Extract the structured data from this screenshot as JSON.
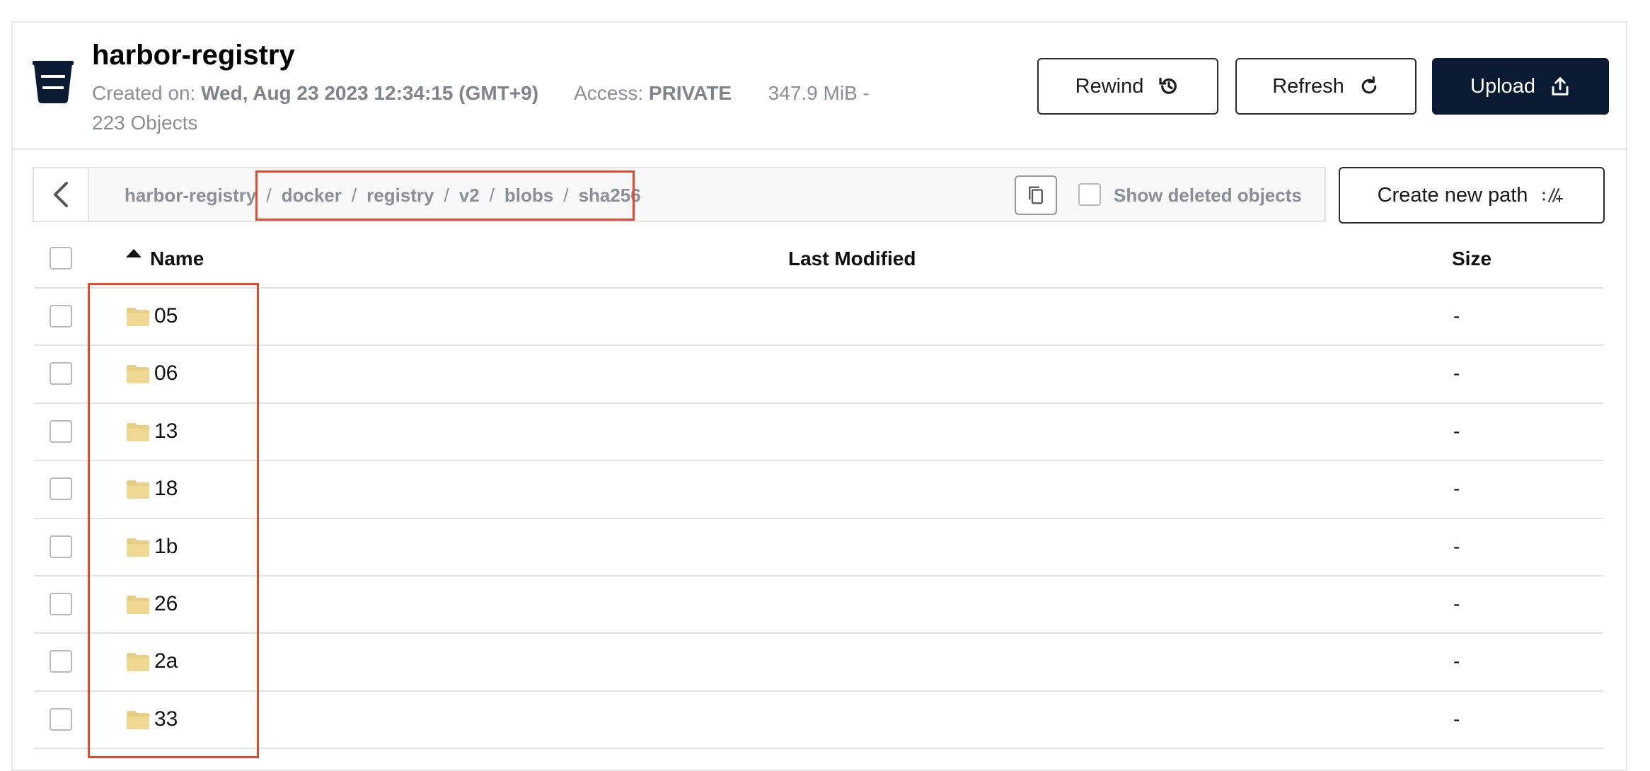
{
  "bucket": {
    "name": "harbor-registry",
    "created_label": "Created on:",
    "created_value": "Wed, Aug 23 2023 12:34:15 (GMT+9)",
    "access_label": "Access:",
    "access_value": "PRIVATE",
    "size_text": "347.9 MiB -",
    "objects_text": "223 Objects"
  },
  "toolbar": {
    "rewind_label": "Rewind",
    "refresh_label": "Refresh",
    "upload_label": "Upload",
    "create_path_label": "Create new path"
  },
  "breadcrumb": {
    "items": [
      "harbor-registry",
      "docker",
      "registry",
      "v2",
      "blobs",
      "sha256"
    ],
    "separator": "/"
  },
  "options": {
    "show_deleted_label": "Show deleted objects",
    "show_deleted_checked": false
  },
  "table": {
    "columns": {
      "name": "Name",
      "last_modified": "Last Modified",
      "size": "Size"
    },
    "rows": [
      {
        "name": "05",
        "last_modified": "",
        "size": "-"
      },
      {
        "name": "06",
        "last_modified": "",
        "size": "-"
      },
      {
        "name": "13",
        "last_modified": "",
        "size": "-"
      },
      {
        "name": "18",
        "last_modified": "",
        "size": "-"
      },
      {
        "name": "1b",
        "last_modified": "",
        "size": "-"
      },
      {
        "name": "26",
        "last_modified": "",
        "size": "-"
      },
      {
        "name": "2a",
        "last_modified": "",
        "size": "-"
      },
      {
        "name": "33",
        "last_modified": "",
        "size": "-"
      }
    ]
  },
  "colors": {
    "primary": "#0b1a33",
    "highlight": "#e24a2e",
    "folder": "#e8cf86",
    "muted_text": "#8a8f96"
  },
  "icons": {
    "bucket": "bucket-icon",
    "rewind": "history-icon",
    "refresh": "refresh-icon",
    "upload": "upload-icon",
    "create_path": "new-path-icon",
    "back": "chevron-left-icon",
    "copy": "copy-icon",
    "folder": "folder-icon",
    "sort": "sort-asc-icon"
  }
}
